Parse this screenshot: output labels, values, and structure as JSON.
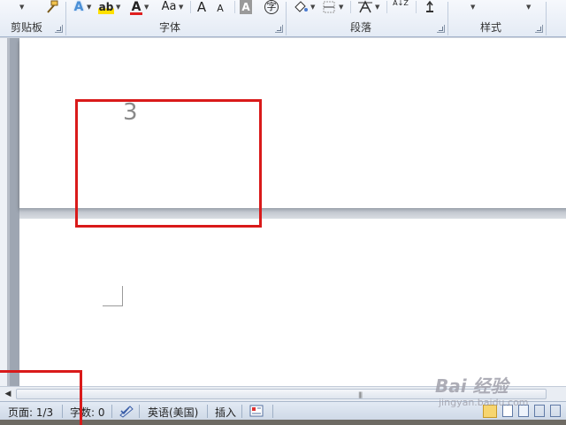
{
  "ribbon": {
    "groups": {
      "clipboard": "剪贴板",
      "font": "字体",
      "paragraph": "段落",
      "styles": "样式"
    },
    "font_size_grow": "A",
    "font_size_shrink": "A",
    "change_case": "Aa",
    "char_shading": "A",
    "phonetic": "字",
    "sort": "A↓Z"
  },
  "document": {
    "page_number_text": "3"
  },
  "statusbar": {
    "page": "页面: 1/3",
    "word_count": "字数: 0",
    "language": "英语(美国)",
    "insert_mode": "插入"
  },
  "watermark": {
    "logo": "Bai 经验",
    "url": "jingyan.baidu.com"
  },
  "colors": {
    "annotation": "#d91a1a",
    "font_color_bar": "#e02020"
  }
}
